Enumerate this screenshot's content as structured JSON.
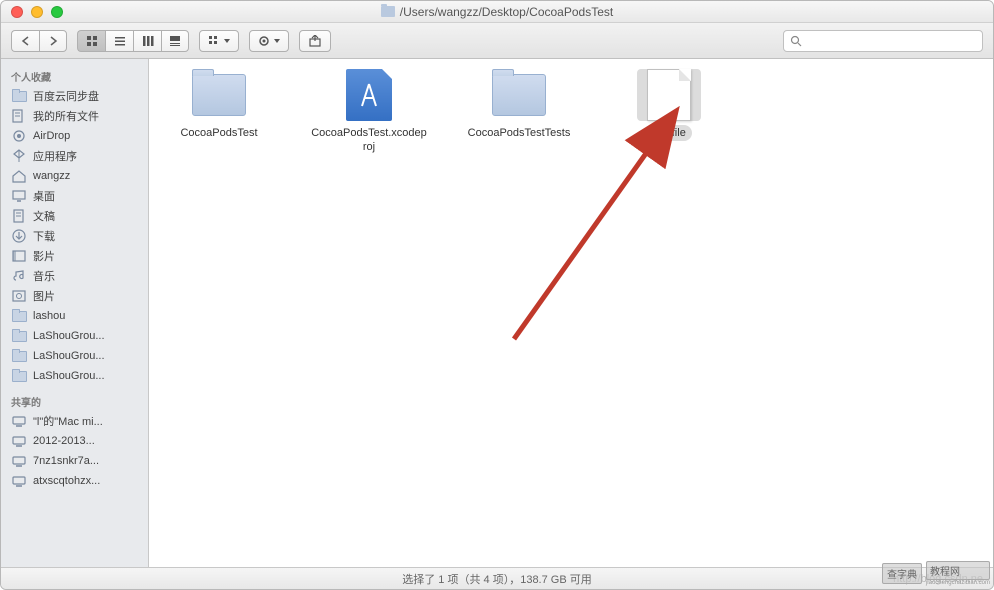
{
  "title": "/Users/wangzz/Desktop/CocoaPodsTest",
  "sidebar": {
    "section1_header": "个人收藏",
    "section2_header": "共享的",
    "favorites": [
      {
        "label": "百度云同步盘",
        "icon": "folder"
      },
      {
        "label": "我的所有文件",
        "icon": "all-files"
      },
      {
        "label": "AirDrop",
        "icon": "airdrop"
      },
      {
        "label": "应用程序",
        "icon": "apps"
      },
      {
        "label": "wangzz",
        "icon": "home"
      },
      {
        "label": "桌面",
        "icon": "desktop"
      },
      {
        "label": "文稿",
        "icon": "documents"
      },
      {
        "label": "下载",
        "icon": "downloads"
      },
      {
        "label": "影片",
        "icon": "movies"
      },
      {
        "label": "音乐",
        "icon": "music"
      },
      {
        "label": "图片",
        "icon": "pictures"
      },
      {
        "label": "lashou",
        "icon": "folder"
      },
      {
        "label": "LaShouGrou...",
        "icon": "folder"
      },
      {
        "label": "LaShouGrou...",
        "icon": "folder"
      },
      {
        "label": "LaShouGrou...",
        "icon": "folder"
      }
    ],
    "shared": [
      {
        "label": "\"l\"的\"Mac mi...",
        "icon": "computer"
      },
      {
        "label": "2012-2013...",
        "icon": "computer"
      },
      {
        "label": "7nz1snkr7a...",
        "icon": "computer"
      },
      {
        "label": "atxscqtohzx...",
        "icon": "computer"
      }
    ]
  },
  "files": [
    {
      "name": "CocoaPodsTest",
      "type": "folder",
      "selected": false
    },
    {
      "name": "CocoaPodsTest.xcodeproj",
      "type": "xcode",
      "selected": false
    },
    {
      "name": "CocoaPodsTestTests",
      "type": "folder",
      "selected": false
    },
    {
      "name": "Podfile",
      "type": "document",
      "selected": true
    }
  ],
  "statusbar": {
    "text": "选择了 1 项（共 4 项），138.7 GB 可用",
    "url": "http://blog.csdn.ne"
  },
  "watermark": {
    "text1": "查字典",
    "text2": "教程网",
    "sub": "jiaochengchazidian.com"
  }
}
